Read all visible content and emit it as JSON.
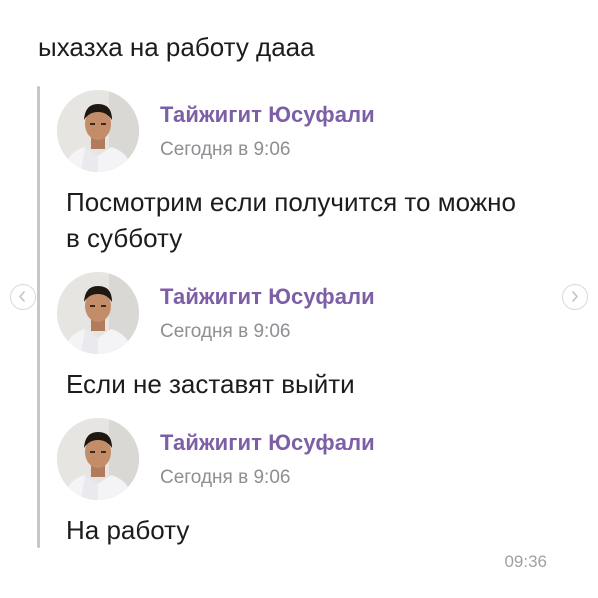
{
  "message": {
    "text": "ыхазха на работу дааа",
    "timestamp": "09:36"
  },
  "forwarded": [
    {
      "author": "Тайжигит Юсуфали",
      "time": "Сегодня в 9:06",
      "text": "Посмотрим если получится то можно в субботу"
    },
    {
      "author": "Тайжигит Юсуфали",
      "time": "Сегодня в 9:06",
      "text": "Если не заставят выйти"
    },
    {
      "author": "Тайжигит Юсуфали",
      "time": "Сегодня в 9:06",
      "text": "На работу"
    }
  ],
  "icons": {
    "avatar": "profile-photo",
    "prev": "chevron-left-icon",
    "next": "chevron-right-icon"
  },
  "colors": {
    "author": "#7d5fa5",
    "meta": "#8e8e93",
    "quote_bar": "#c6c6cc"
  }
}
